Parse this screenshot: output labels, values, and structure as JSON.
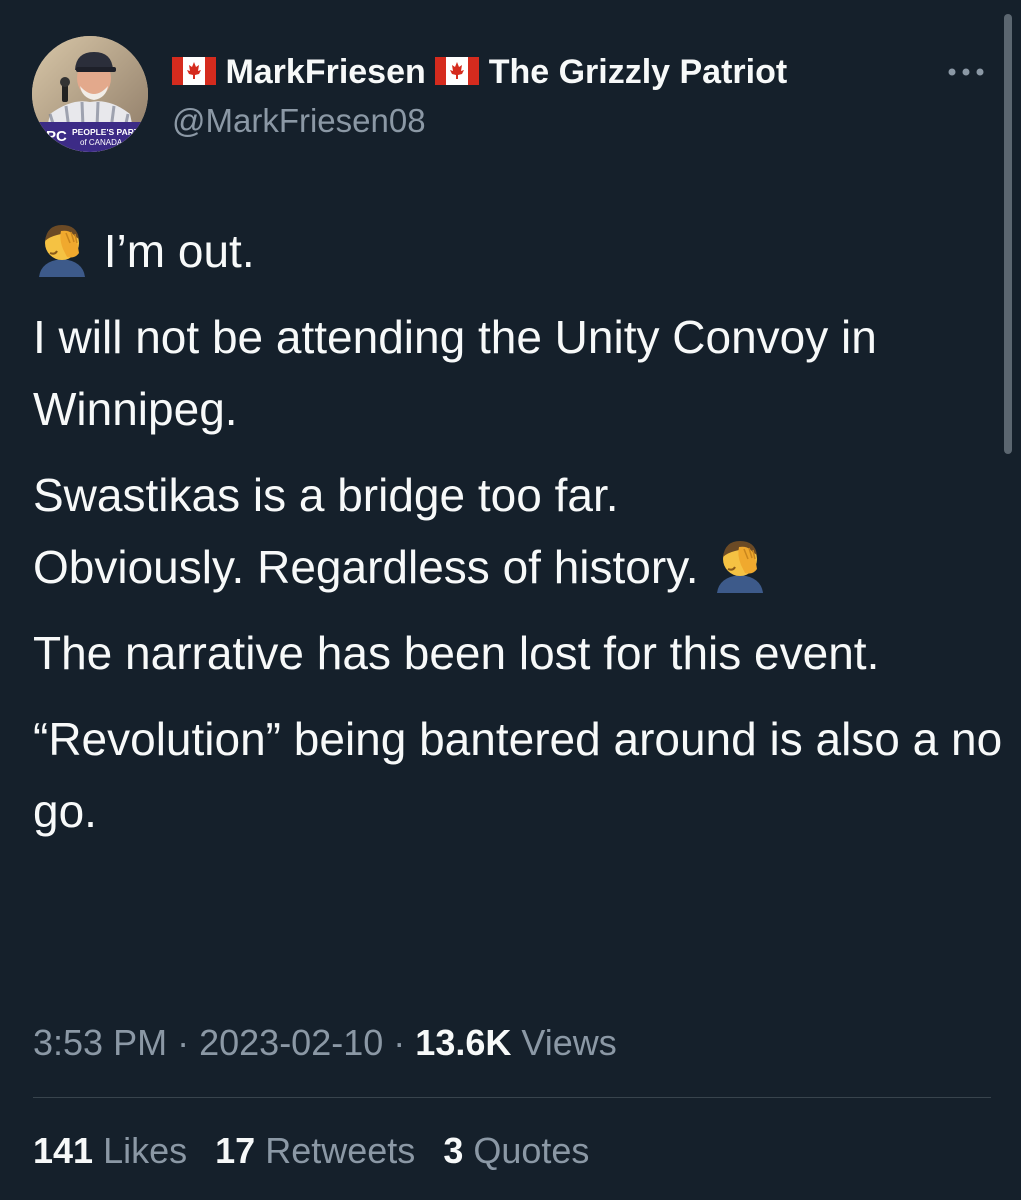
{
  "author": {
    "display_name_part1": "MarkFriesen",
    "display_name_part2": "The Grizzly Patriot",
    "handle": "@MarkFriesen08",
    "avatar_banner_text_line1": "PEOPLE'S PART",
    "avatar_banner_text_line2": "of CANADA",
    "avatar_logo_text": "PPC",
    "flag_icon": "canada-flag-icon"
  },
  "tweet": {
    "line1": "I’m out.",
    "paragraph2": "I will not be attending the Unity Convoy in Winnipeg.",
    "paragraph3_line1": "Swastikas is a bridge too far.",
    "paragraph3_line2": "Obviously. Regardless of history.",
    "paragraph4": "The narrative has been lost for this event.",
    "paragraph5": "“Revolution” being bantered around is also a no go.",
    "emoji_icon": "face-palm-icon"
  },
  "meta": {
    "time": "3:53 PM",
    "separator": "·",
    "date": "2023-02-10",
    "views_count": "13.6K",
    "views_label": "Views"
  },
  "stats": {
    "likes_count": "141",
    "likes_label": "Likes",
    "retweets_count": "17",
    "retweets_label": "Retweets",
    "quotes_count": "3",
    "quotes_label": "Quotes"
  },
  "colors": {
    "background": "#15202b",
    "text_primary": "#f7f9f9",
    "text_secondary": "#8b98a5",
    "divider": "#38444d",
    "flag_red": "#d52b1e"
  }
}
